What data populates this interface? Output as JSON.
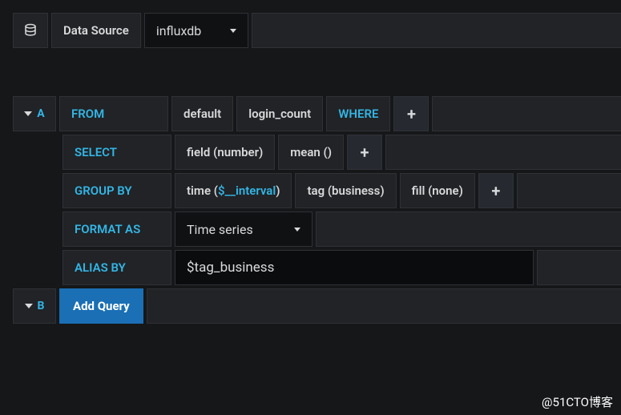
{
  "header": {
    "data_source_label": "Data Source",
    "data_source_value": "influxdb"
  },
  "queryA": {
    "letter": "A",
    "from": {
      "label": "FROM",
      "policy": "default",
      "measurement": "login_count",
      "where_label": "WHERE"
    },
    "select": {
      "label": "SELECT",
      "items": [
        "field (number)",
        "mean ()"
      ]
    },
    "group_by": {
      "label": "GROUP BY",
      "time_prefix": "time (",
      "time_var": "$__interval",
      "time_suffix": ")",
      "tag": "tag (business)",
      "fill": "fill (none)"
    },
    "format_as": {
      "label": "FORMAT AS",
      "value": "Time series"
    },
    "alias_by": {
      "label": "ALIAS BY",
      "value": "$tag_business"
    }
  },
  "queryB": {
    "letter": "B",
    "add_query_label": "Add Query"
  },
  "watermark": "@51CTO博客"
}
